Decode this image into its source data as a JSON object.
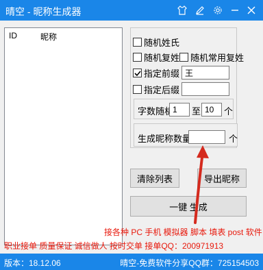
{
  "window": {
    "title": "晴空 - 昵称生成器"
  },
  "list": {
    "col_id": "ID",
    "col_nickname": "昵称"
  },
  "options": {
    "random_surname": {
      "label": "随机姓氏",
      "checked": false
    },
    "random_compound_surname": {
      "label": "随机复姓",
      "checked": false
    },
    "random_common_compound": {
      "label": "随机常用复姓",
      "checked": false
    },
    "specify_prefix": {
      "label": "指定前缀",
      "checked": true,
      "value": "王"
    },
    "specify_suffix": {
      "label": "指定后缀",
      "checked": false,
      "value": ""
    }
  },
  "char_count": {
    "label": "字数随机",
    "min": "1",
    "to": "至",
    "max": "10",
    "unit": "个"
  },
  "gen_count": {
    "label": "生成昵称数量",
    "value": "",
    "unit": "个"
  },
  "buttons": {
    "clear": "清除列表",
    "export": "导出昵称",
    "generate": "一键 生成"
  },
  "promo": {
    "line1": "接各种 PC 手机 模拟器 脚本 填表 post 软件",
    "line2": "职业接单 质量保证 诚信做人 按时交单  接单QQ：200971913"
  },
  "status": {
    "version": "版本：18.12.06",
    "share": "晴空-免费软件分享QQ群：725154503"
  },
  "colors": {
    "titlebar": "#1a86e8",
    "promo_text": "#e8190c",
    "arrow": "#d42a1e"
  },
  "icons": [
    "skin-icon",
    "edit-icon",
    "settings-icon",
    "minimize-icon",
    "close-icon"
  ]
}
